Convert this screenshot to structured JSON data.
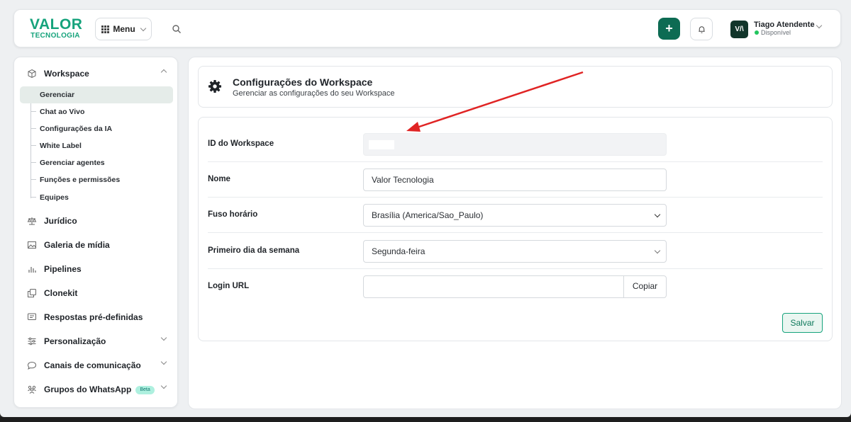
{
  "header": {
    "logo_top": "VALOR",
    "logo_bottom": "TECNOLOGIA",
    "menu_label": "Menu",
    "add_label": "+",
    "user": {
      "name": "Tiago Atendente",
      "status": "Disponível",
      "avatar_text": "V/\\"
    }
  },
  "sidebar": {
    "section": {
      "label": "Workspace",
      "icon": "cube-icon"
    },
    "sub_items": [
      {
        "label": "Gerenciar",
        "active": true
      },
      {
        "label": "Chat ao Vivo"
      },
      {
        "label": "Configurações da IA"
      },
      {
        "label": "White Label"
      },
      {
        "label": "Gerenciar agentes"
      },
      {
        "label": "Funções e permissões"
      },
      {
        "label": "Equipes"
      }
    ],
    "items": [
      {
        "label": "Jurídico",
        "icon": "scale-icon"
      },
      {
        "label": "Galeria de mídia",
        "icon": "image-icon"
      },
      {
        "label": "Pipelines",
        "icon": "bar-chart-icon"
      },
      {
        "label": "Clonekit",
        "icon": "copy-icon"
      },
      {
        "label": "Respostas pré-definidas",
        "icon": "message-icon"
      },
      {
        "label": "Personalização",
        "icon": "sliders-icon"
      },
      {
        "label": "Canais de comunicação",
        "icon": "chat-bubble-icon"
      },
      {
        "label": "Grupos do WhatsApp",
        "icon": "users-icon",
        "badge": "Beta"
      }
    ]
  },
  "page": {
    "title": "Configurações do Workspace",
    "subtitle": "Gerenciar as configurações do seu Workspace"
  },
  "form": {
    "workspace_id_label": "ID do Workspace",
    "name_label": "Nome",
    "name_value": "Valor Tecnologia",
    "timezone_label": "Fuso horário",
    "timezone_value": "Brasília (America/Sao_Paulo)",
    "first_day_label": "Primeiro dia da semana",
    "first_day_value": "Segunda-feira",
    "login_url_label": "Login URL",
    "copy_label": "Copiar",
    "save_label": "Salvar"
  },
  "colors": {
    "brand": "#16a37c",
    "brand_dark": "#0d6b53",
    "annotation_arrow": "#e02424"
  }
}
